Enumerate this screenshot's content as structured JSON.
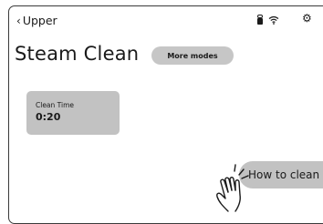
{
  "header": {
    "back_label": "Upper",
    "back_icon": "chevron-left-icon",
    "status_icons": [
      "lock-icon",
      "wifi-icon"
    ],
    "settings_icon": "gear-icon"
  },
  "main": {
    "title": "Steam Clean",
    "more_modes_label": "More modes",
    "tile": {
      "label": "Clean Time",
      "value": "0:20"
    },
    "how_to_clean_label": "How to clean"
  },
  "colors": {
    "button_bg": "#c6c6c6",
    "tile_bg": "#c2c2c2",
    "text": "#1a1a1a",
    "border": "#3a3a3a"
  }
}
